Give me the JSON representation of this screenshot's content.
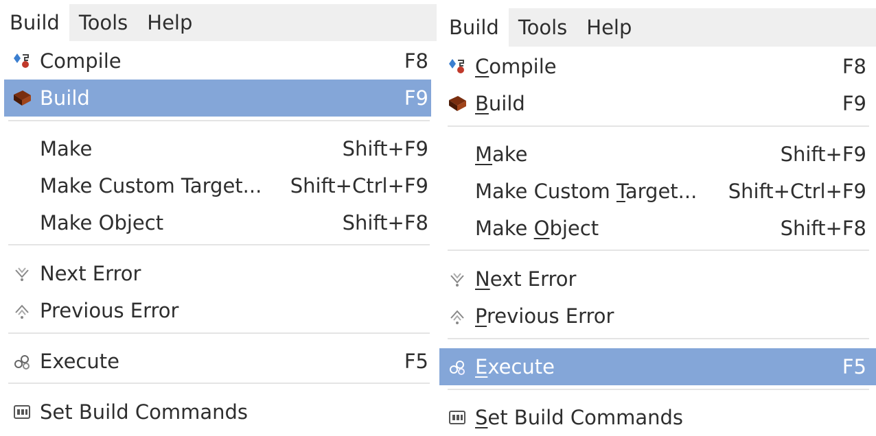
{
  "left": {
    "menubar": [
      "Build",
      "Tools",
      "Help"
    ],
    "items": [
      {
        "label": "Compile",
        "accel": "F8",
        "icon": "compile-icon"
      },
      {
        "label": "Build",
        "accel": "F9",
        "icon": "build-brick-icon"
      },
      {
        "label": "Make",
        "accel": "Shift+F9"
      },
      {
        "label": "Make Custom Target...",
        "accel": "Shift+Ctrl+F9"
      },
      {
        "label": "Make Object",
        "accel": "Shift+F8"
      },
      {
        "label": "Next Error",
        "icon": "next-error-icon"
      },
      {
        "label": "Previous Error",
        "icon": "previous-error-icon"
      },
      {
        "label": "Execute",
        "accel": "F5",
        "icon": "execute-icon"
      },
      {
        "label": "Set Build Commands",
        "icon": "set-build-commands-icon"
      }
    ],
    "highlighted": "Build"
  },
  "right": {
    "menubar": [
      "Build",
      "Tools",
      "Help"
    ],
    "items": [
      {
        "pre": "",
        "mn": "C",
        "post": "ompile",
        "accel": "F8"
      },
      {
        "pre": "",
        "mn": "B",
        "post": "uild",
        "accel": "F9"
      },
      {
        "pre": "",
        "mn": "M",
        "post": "ake",
        "accel": "Shift+F9"
      },
      {
        "pre": "Make Custom ",
        "mn": "T",
        "post": "arget...",
        "accel": "Shift+Ctrl+F9"
      },
      {
        "pre": "Make ",
        "mn": "O",
        "post": "bject",
        "accel": "Shift+F8"
      },
      {
        "pre": "",
        "mn": "N",
        "post": "ext Error"
      },
      {
        "pre": "",
        "mn": "P",
        "post": "revious Error"
      },
      {
        "pre": "",
        "mn": "E",
        "post": "xecute",
        "accel": "F5"
      },
      {
        "pre": "",
        "mn": "S",
        "post": "et Build Commands"
      }
    ],
    "highlighted": "Execute"
  },
  "colors": {
    "highlight": "#84a6d8",
    "menubar": "#efefef",
    "separator": "#e4e4e4",
    "text": "#2e2e2e"
  }
}
